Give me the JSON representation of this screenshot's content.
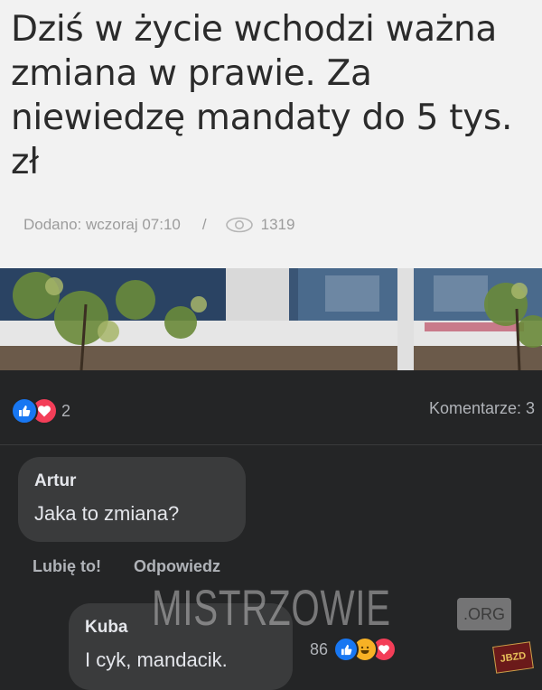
{
  "article": {
    "headline": "Dziś w życie wchodzi ważna zmiana w prawie. Za niewiedzę mandaty do 5 tys. zł",
    "added_label": "Dodano: wczoraj 07:10",
    "separator": "/",
    "views": "1319"
  },
  "post": {
    "reaction_count": "2",
    "comments_label": "Komentarze: 3"
  },
  "comments": [
    {
      "author": "Artur",
      "text": "Jaka to zmiana?"
    },
    {
      "author": "Kuba",
      "text": "I cyk, mandacik.",
      "reaction_count": "86"
    }
  ],
  "comment_actions": {
    "like": "Lubię to!",
    "reply": "Odpowiedz"
  },
  "watermark": {
    "text": "MISTRZOWIE",
    "suffix": ".ORG",
    "badge": "JBZD"
  },
  "colors": {
    "like_blue": "#1877f2",
    "heart_red": "#f33e58",
    "haha_yellow": "#f7b125",
    "dark_bg": "#242526"
  },
  "icons": [
    "eye-icon",
    "like-icon",
    "heart-icon",
    "haha-icon"
  ]
}
